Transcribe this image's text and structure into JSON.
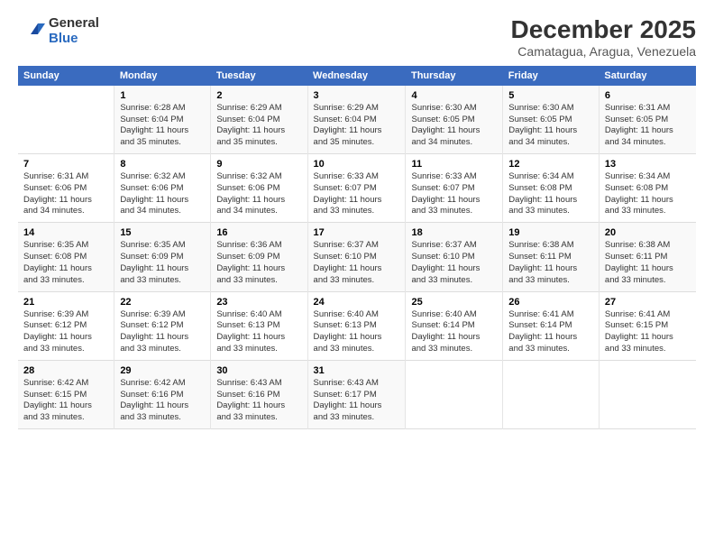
{
  "logo": {
    "general": "General",
    "blue": "Blue"
  },
  "title": "December 2025",
  "subtitle": "Camatagua, Aragua, Venezuela",
  "days_header": [
    "Sunday",
    "Monday",
    "Tuesday",
    "Wednesday",
    "Thursday",
    "Friday",
    "Saturday"
  ],
  "weeks": [
    [
      {
        "num": "",
        "info": ""
      },
      {
        "num": "1",
        "info": "Sunrise: 6:28 AM\nSunset: 6:04 PM\nDaylight: 11 hours\nand 35 minutes."
      },
      {
        "num": "2",
        "info": "Sunrise: 6:29 AM\nSunset: 6:04 PM\nDaylight: 11 hours\nand 35 minutes."
      },
      {
        "num": "3",
        "info": "Sunrise: 6:29 AM\nSunset: 6:04 PM\nDaylight: 11 hours\nand 35 minutes."
      },
      {
        "num": "4",
        "info": "Sunrise: 6:30 AM\nSunset: 6:05 PM\nDaylight: 11 hours\nand 34 minutes."
      },
      {
        "num": "5",
        "info": "Sunrise: 6:30 AM\nSunset: 6:05 PM\nDaylight: 11 hours\nand 34 minutes."
      },
      {
        "num": "6",
        "info": "Sunrise: 6:31 AM\nSunset: 6:05 PM\nDaylight: 11 hours\nand 34 minutes."
      }
    ],
    [
      {
        "num": "7",
        "info": "Sunrise: 6:31 AM\nSunset: 6:06 PM\nDaylight: 11 hours\nand 34 minutes."
      },
      {
        "num": "8",
        "info": "Sunrise: 6:32 AM\nSunset: 6:06 PM\nDaylight: 11 hours\nand 34 minutes."
      },
      {
        "num": "9",
        "info": "Sunrise: 6:32 AM\nSunset: 6:06 PM\nDaylight: 11 hours\nand 34 minutes."
      },
      {
        "num": "10",
        "info": "Sunrise: 6:33 AM\nSunset: 6:07 PM\nDaylight: 11 hours\nand 33 minutes."
      },
      {
        "num": "11",
        "info": "Sunrise: 6:33 AM\nSunset: 6:07 PM\nDaylight: 11 hours\nand 33 minutes."
      },
      {
        "num": "12",
        "info": "Sunrise: 6:34 AM\nSunset: 6:08 PM\nDaylight: 11 hours\nand 33 minutes."
      },
      {
        "num": "13",
        "info": "Sunrise: 6:34 AM\nSunset: 6:08 PM\nDaylight: 11 hours\nand 33 minutes."
      }
    ],
    [
      {
        "num": "14",
        "info": "Sunrise: 6:35 AM\nSunset: 6:08 PM\nDaylight: 11 hours\nand 33 minutes."
      },
      {
        "num": "15",
        "info": "Sunrise: 6:35 AM\nSunset: 6:09 PM\nDaylight: 11 hours\nand 33 minutes."
      },
      {
        "num": "16",
        "info": "Sunrise: 6:36 AM\nSunset: 6:09 PM\nDaylight: 11 hours\nand 33 minutes."
      },
      {
        "num": "17",
        "info": "Sunrise: 6:37 AM\nSunset: 6:10 PM\nDaylight: 11 hours\nand 33 minutes."
      },
      {
        "num": "18",
        "info": "Sunrise: 6:37 AM\nSunset: 6:10 PM\nDaylight: 11 hours\nand 33 minutes."
      },
      {
        "num": "19",
        "info": "Sunrise: 6:38 AM\nSunset: 6:11 PM\nDaylight: 11 hours\nand 33 minutes."
      },
      {
        "num": "20",
        "info": "Sunrise: 6:38 AM\nSunset: 6:11 PM\nDaylight: 11 hours\nand 33 minutes."
      }
    ],
    [
      {
        "num": "21",
        "info": "Sunrise: 6:39 AM\nSunset: 6:12 PM\nDaylight: 11 hours\nand 33 minutes."
      },
      {
        "num": "22",
        "info": "Sunrise: 6:39 AM\nSunset: 6:12 PM\nDaylight: 11 hours\nand 33 minutes."
      },
      {
        "num": "23",
        "info": "Sunrise: 6:40 AM\nSunset: 6:13 PM\nDaylight: 11 hours\nand 33 minutes."
      },
      {
        "num": "24",
        "info": "Sunrise: 6:40 AM\nSunset: 6:13 PM\nDaylight: 11 hours\nand 33 minutes."
      },
      {
        "num": "25",
        "info": "Sunrise: 6:40 AM\nSunset: 6:14 PM\nDaylight: 11 hours\nand 33 minutes."
      },
      {
        "num": "26",
        "info": "Sunrise: 6:41 AM\nSunset: 6:14 PM\nDaylight: 11 hours\nand 33 minutes."
      },
      {
        "num": "27",
        "info": "Sunrise: 6:41 AM\nSunset: 6:15 PM\nDaylight: 11 hours\nand 33 minutes."
      }
    ],
    [
      {
        "num": "28",
        "info": "Sunrise: 6:42 AM\nSunset: 6:15 PM\nDaylight: 11 hours\nand 33 minutes."
      },
      {
        "num": "29",
        "info": "Sunrise: 6:42 AM\nSunset: 6:16 PM\nDaylight: 11 hours\nand 33 minutes."
      },
      {
        "num": "30",
        "info": "Sunrise: 6:43 AM\nSunset: 6:16 PM\nDaylight: 11 hours\nand 33 minutes."
      },
      {
        "num": "31",
        "info": "Sunrise: 6:43 AM\nSunset: 6:17 PM\nDaylight: 11 hours\nand 33 minutes."
      },
      {
        "num": "",
        "info": ""
      },
      {
        "num": "",
        "info": ""
      },
      {
        "num": "",
        "info": ""
      }
    ]
  ]
}
